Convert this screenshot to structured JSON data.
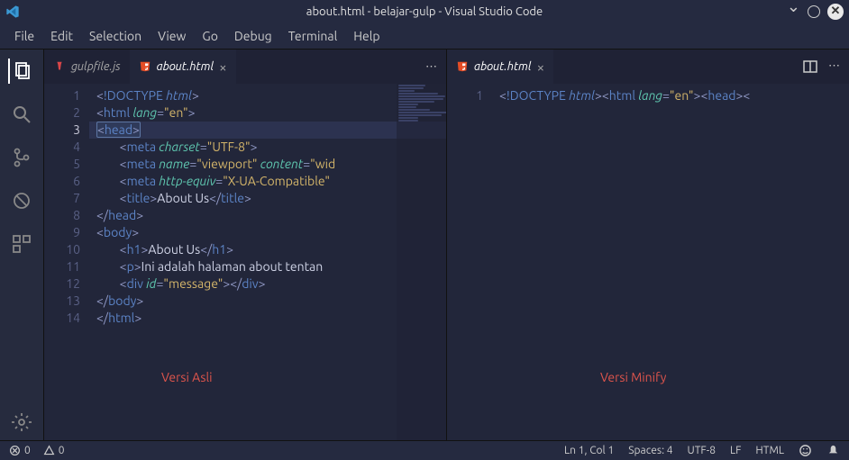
{
  "title": "about.html - belajar-gulp - Visual Studio Code",
  "menu": [
    "File",
    "Edit",
    "Selection",
    "View",
    "Go",
    "Debug",
    "Terminal",
    "Help"
  ],
  "tabs_left": [
    {
      "label": "gulpfile.js",
      "active": false,
      "closable": false,
      "icon": "gulp"
    },
    {
      "label": "about.html",
      "active": true,
      "closable": true,
      "icon": "html"
    }
  ],
  "tabs_right": [
    {
      "label": "about.html",
      "active": true,
      "closable": true,
      "icon": "html"
    }
  ],
  "left_doc": {
    "lines": [
      {
        "n": 1,
        "segs": [
          [
            "<",
            "p"
          ],
          [
            "!DOCTYPE ",
            "doctype"
          ],
          [
            "html",
            "kw"
          ],
          [
            ">",
            "p"
          ]
        ]
      },
      {
        "n": 2,
        "segs": [
          [
            "<",
            "p"
          ],
          [
            "html ",
            "tag"
          ],
          [
            "lang",
            "attr"
          ],
          [
            "=",
            "p"
          ],
          [
            "\"en\"",
            "str"
          ],
          [
            ">",
            "p"
          ]
        ]
      },
      {
        "n": 3,
        "current": true,
        "segs": [
          [
            "<",
            "p"
          ],
          [
            "head",
            "tag"
          ],
          [
            ">",
            "p"
          ]
        ],
        "highlight_box": true
      },
      {
        "n": 4,
        "indent": 2,
        "segs": [
          [
            "<",
            "p"
          ],
          [
            "meta ",
            "tag"
          ],
          [
            "charset",
            "attr"
          ],
          [
            "=",
            "p"
          ],
          [
            "\"UTF-8\"",
            "str"
          ],
          [
            ">",
            "p"
          ]
        ]
      },
      {
        "n": 5,
        "indent": 2,
        "segs": [
          [
            "<",
            "p"
          ],
          [
            "meta ",
            "tag"
          ],
          [
            "name",
            "attr"
          ],
          [
            "=",
            "p"
          ],
          [
            "\"viewport\" ",
            "str"
          ],
          [
            "content",
            "attr"
          ],
          [
            "=",
            "p"
          ],
          [
            "\"wid",
            "str"
          ]
        ]
      },
      {
        "n": 6,
        "indent": 2,
        "segs": [
          [
            "<",
            "p"
          ],
          [
            "meta ",
            "tag"
          ],
          [
            "http-equiv",
            "attr"
          ],
          [
            "=",
            "p"
          ],
          [
            "\"X-UA-Compatible\"",
            "str"
          ]
        ]
      },
      {
        "n": 7,
        "indent": 2,
        "segs": [
          [
            "<",
            "p"
          ],
          [
            "title",
            "tag"
          ],
          [
            ">",
            "p"
          ],
          [
            "About Us",
            "text"
          ],
          [
            "</",
            "p"
          ],
          [
            "title",
            "tag"
          ],
          [
            ">",
            "p"
          ]
        ]
      },
      {
        "n": 8,
        "segs": [
          [
            "</",
            "p"
          ],
          [
            "head",
            "tag"
          ],
          [
            ">",
            "p"
          ]
        ]
      },
      {
        "n": 9,
        "segs": [
          [
            "<",
            "p"
          ],
          [
            "body",
            "tag"
          ],
          [
            ">",
            "p"
          ]
        ]
      },
      {
        "n": 10,
        "indent": 2,
        "segs": [
          [
            "<",
            "p"
          ],
          [
            "h1",
            "tag"
          ],
          [
            ">",
            "p"
          ],
          [
            "About Us",
            "text"
          ],
          [
            "</",
            "p"
          ],
          [
            "h1",
            "tag"
          ],
          [
            ">",
            "p"
          ]
        ]
      },
      {
        "n": 11,
        "indent": 2,
        "segs": [
          [
            "<",
            "p"
          ],
          [
            "p",
            "tag"
          ],
          [
            ">",
            "p"
          ],
          [
            "Ini adalah halaman about tentan",
            "text"
          ]
        ]
      },
      {
        "n": 12,
        "indent": 2,
        "segs": [
          [
            "<",
            "p"
          ],
          [
            "div ",
            "tag"
          ],
          [
            "id",
            "attr"
          ],
          [
            "=",
            "p"
          ],
          [
            "\"message\"",
            "str"
          ],
          [
            "></",
            "p"
          ],
          [
            "div",
            "tag"
          ],
          [
            ">",
            "p"
          ]
        ]
      },
      {
        "n": 13,
        "segs": [
          [
            "</",
            "p"
          ],
          [
            "body",
            "tag"
          ],
          [
            ">",
            "p"
          ]
        ]
      },
      {
        "n": 14,
        "segs": [
          [
            "</",
            "p"
          ],
          [
            "html",
            "tag"
          ],
          [
            ">",
            "p"
          ]
        ]
      }
    ]
  },
  "right_doc": {
    "lines": [
      {
        "n": 1,
        "segs": [
          [
            "<",
            "p"
          ],
          [
            "!DOCTYPE ",
            "doctype"
          ],
          [
            "html",
            "kw"
          ],
          [
            ">",
            "p"
          ],
          [
            "<",
            "p"
          ],
          [
            "html ",
            "tag"
          ],
          [
            "lang",
            "attr"
          ],
          [
            "=",
            "p"
          ],
          [
            "\"en\"",
            "str"
          ],
          [
            "><",
            "p"
          ],
          [
            "head",
            "tag"
          ],
          [
            "><",
            "p"
          ]
        ],
        "highlight_box": true
      }
    ]
  },
  "overlay_left": "Versi Asli",
  "overlay_right": "Versi Minify",
  "status": {
    "errors": "0",
    "warnings": "0",
    "cursor": "Ln 1, Col 1",
    "spaces": "Spaces: 4",
    "encoding": "UTF-8",
    "eol": "LF",
    "lang": "HTML"
  },
  "colors": {
    "accent": "#e4552b"
  }
}
